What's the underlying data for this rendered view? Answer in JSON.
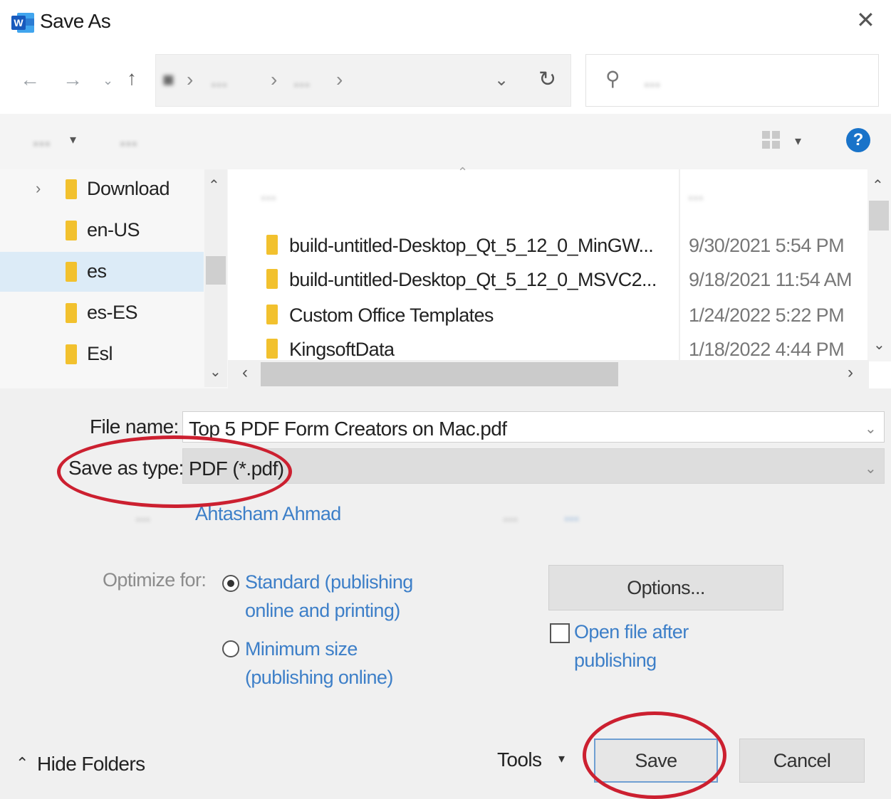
{
  "window": {
    "title": "Save As",
    "app_icon": "word-icon",
    "accent": "#1973c9"
  },
  "nav": {
    "back_icon": "arrow-left-icon",
    "forward_icon": "arrow-right-icon",
    "recent_icon": "chevron-down-icon",
    "up_icon": "arrow-up-icon",
    "breadcrumbs": [
      "■",
      "...",
      "..."
    ],
    "refresh_icon": "refresh-icon",
    "search_icon": "search-icon",
    "search_placeholder": "..."
  },
  "toolbar": {
    "organize": "...",
    "new_folder": "...",
    "view_icon": "view-grid-icon",
    "help_label": "?"
  },
  "folders": [
    {
      "label": "Download",
      "expandable": true,
      "selected": false
    },
    {
      "label": "en-US",
      "expandable": false,
      "selected": false
    },
    {
      "label": "es",
      "expandable": false,
      "selected": true
    },
    {
      "label": "es-ES",
      "expandable": false,
      "selected": false
    },
    {
      "label": "Esl",
      "expandable": false,
      "selected": false
    }
  ],
  "files": {
    "columns": {
      "name": "...",
      "date_modified": "..."
    },
    "rows": [
      {
        "name": "build-untitled-Desktop_Qt_5_12_0_MinGW...",
        "date": "9/30/2021 5:54 PM"
      },
      {
        "name": "build-untitled-Desktop_Qt_5_12_0_MSVC2...",
        "date": "9/18/2021 11:54 AM"
      },
      {
        "name": "Custom Office Templates",
        "date": "1/24/2022 5:22 PM"
      },
      {
        "name": "KingsoftData",
        "date": "1/18/2022 4:44 PM"
      }
    ]
  },
  "form": {
    "file_name_label": "File name:",
    "file_name_value": "Top 5 PDF Form Creators on Mac.pdf",
    "save_type_label": "Save as type:",
    "save_type_value": "PDF (*.pdf)",
    "authors_label": "...",
    "authors_value": "Ahtasham Ahmad",
    "tags_label": "...",
    "tags_value": "..."
  },
  "options": {
    "optimize_label": "Optimize for:",
    "standard_line1": "Standard (publishing",
    "standard_line2": "online and printing)",
    "minimum_line1": "Minimum size",
    "minimum_line2": "(publishing online)",
    "standard_selected": true,
    "options_button": "Options...",
    "open_after_line1": "Open file after",
    "open_after_line2": "publishing",
    "open_after_checked": false
  },
  "footer": {
    "hide_folders": "Hide Folders",
    "tools": "Tools",
    "save": "Save",
    "cancel": "Cancel"
  },
  "annotations": {
    "highlight_color": "#cc2030"
  }
}
